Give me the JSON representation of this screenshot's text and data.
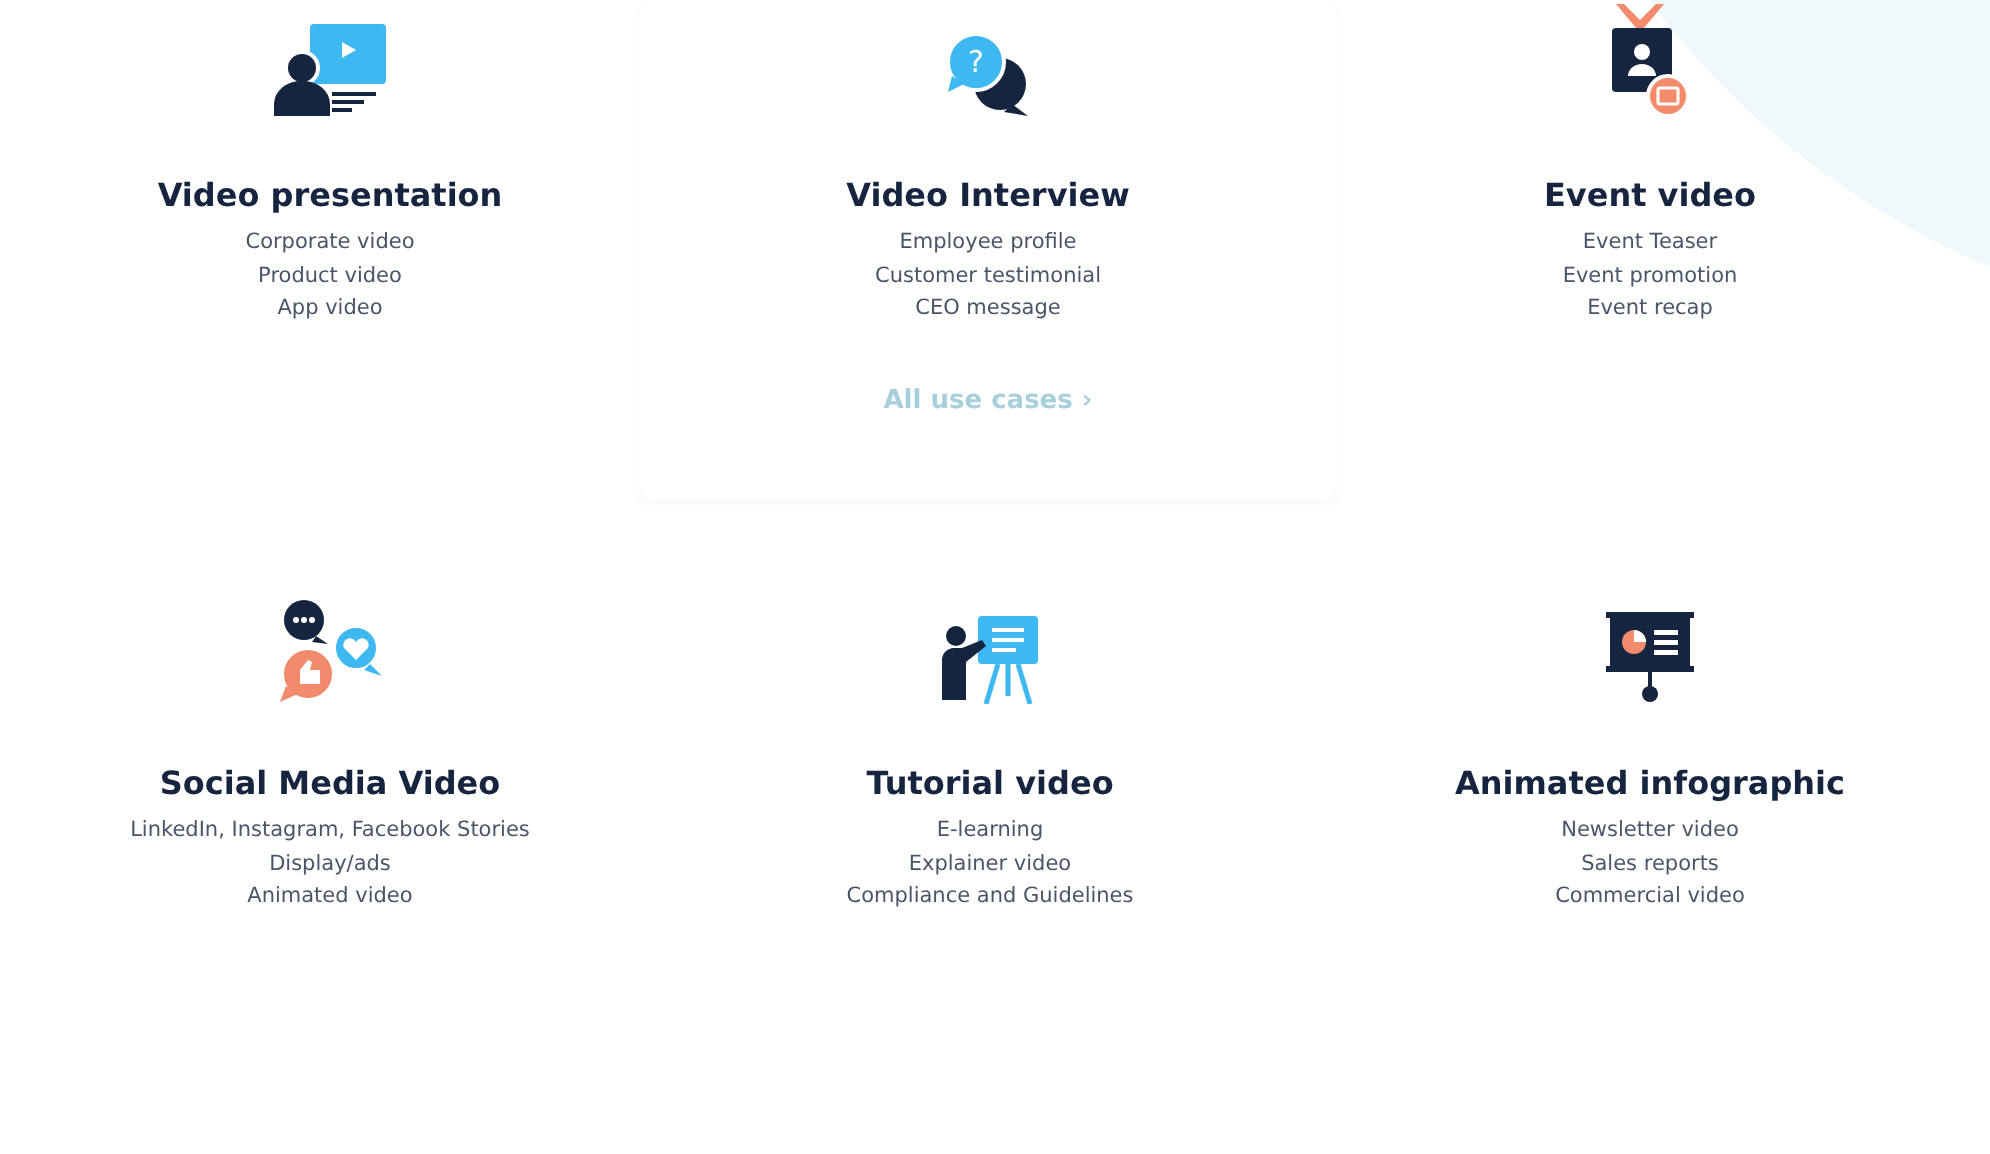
{
  "use_cases": [
    {
      "kind": "presentation",
      "title": "Video presentation",
      "items": [
        "Corporate video",
        "Product video",
        "App video"
      ],
      "highlighted": false
    },
    {
      "kind": "interview",
      "icon_text": "?",
      "title": "Video Interview",
      "items": [
        "Employee profile",
        "Customer testimonial",
        "CEO message"
      ],
      "highlighted": true,
      "link": "All use cases",
      "link_arrow": "›"
    },
    {
      "kind": "event",
      "title": "Event video",
      "items": [
        "Event Teaser",
        "Event promotion",
        "Event recap"
      ],
      "highlighted": false
    },
    {
      "kind": "social",
      "title": "Social Media Video",
      "items": [
        "LinkedIn, Instagram, Facebook Stories",
        "Display/ads",
        "Animated video"
      ],
      "highlighted": false
    },
    {
      "kind": "tutorial",
      "title": "Tutorial video",
      "items": [
        "E-learning",
        "Explainer video",
        "Compliance and Guidelines"
      ],
      "highlighted": false
    },
    {
      "kind": "infographic",
      "title": "Animated infographic",
      "items": [
        "Newsletter video",
        "Sales reports",
        "Commercial video"
      ],
      "highlighted": false
    }
  ]
}
